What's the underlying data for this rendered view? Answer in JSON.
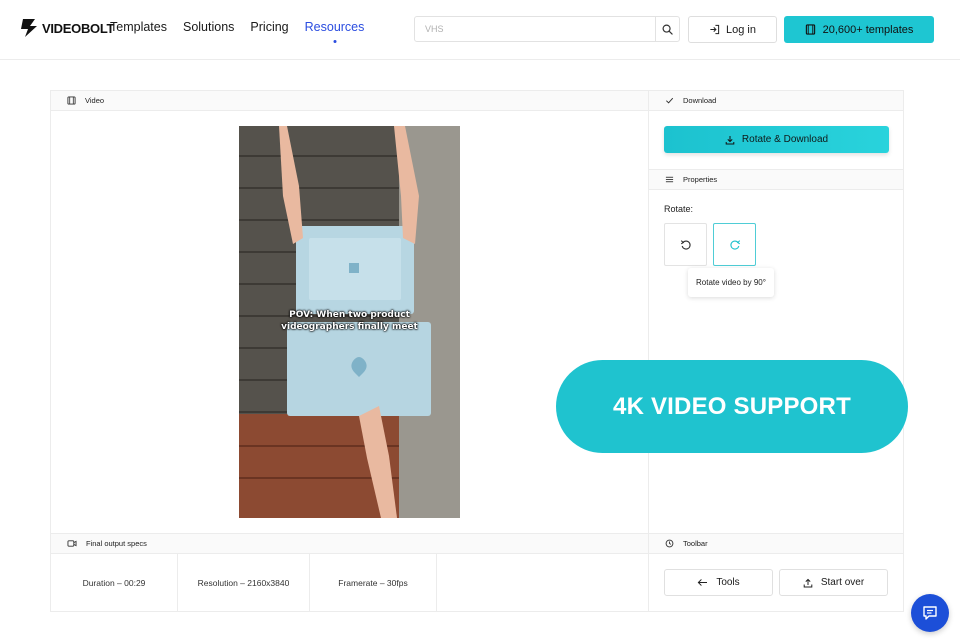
{
  "brand": {
    "name": "VIDEOBOLT",
    "accent": "#1ec6d2",
    "link": "#2b4de0"
  },
  "nav": {
    "items": [
      {
        "label": "Templates",
        "active": false
      },
      {
        "label": "Solutions",
        "active": false
      },
      {
        "label": "Pricing",
        "active": false
      },
      {
        "label": "Resources",
        "active": true
      }
    ]
  },
  "search": {
    "placeholder": "VHS",
    "icon": "search-icon"
  },
  "header_actions": {
    "login_label": "Log in",
    "templates_label": "20,600+ templates"
  },
  "panels": {
    "video": {
      "title": "Video"
    },
    "download": {
      "title": "Download",
      "button_label": "Rotate & Download"
    },
    "properties": {
      "title": "Properties",
      "rotate_label": "Rotate:",
      "tooltip": "Rotate video by 90°"
    },
    "specs": {
      "title": "Final output specs",
      "items": [
        "Duration – 00:29",
        "Resolution – 2160x3840",
        "Framerate – 30fps"
      ]
    },
    "toolbar": {
      "title": "Toolbar",
      "tools_label": "Tools",
      "start_over_label": "Start over"
    }
  },
  "video_caption": {
    "line1": "POV: When two product",
    "line2": "videographers finally meet"
  },
  "banner": {
    "text": "4K VIDEO SUPPORT"
  }
}
